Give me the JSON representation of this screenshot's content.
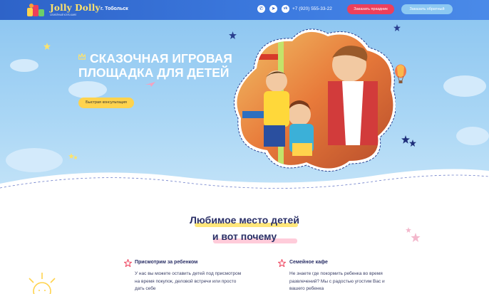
{
  "header": {
    "logo_name": "Jolly Dolly",
    "logo_tagline": "СЕМЕЙНЫЙ КЛУБ-КАФЕ",
    "city": "г. Тобольск",
    "phone": "+7 (920) 555-33-22",
    "order_button": "Заказать праздник",
    "call_button": "Заказать обратный",
    "social_icons": [
      "whatsapp-icon",
      "telegram-icon",
      "vk-icon"
    ]
  },
  "hero": {
    "title": "СКАЗОЧНАЯ ИГРОВАЯ ПЛОЩАДКА ДЛЯ ДЕТЕЙ",
    "consult_button": "Быстрая консультация"
  },
  "section": {
    "heading_line1": "Любимое место детей",
    "heading_line2": "и вот почему",
    "features": [
      {
        "title": "Присмотрим за ребенком",
        "text": "У нас вы можете оставить детей под присмотром на время покупок, деловой встречи или просто дать себе"
      },
      {
        "title": "Семейное кафе",
        "text": "Не знаете где покормить ребенка во время развлечений? Мы с радостью угостим Вас и вашего ребенка"
      }
    ]
  },
  "colors": {
    "header": "#2e63c8",
    "accent_red": "#ee3f5a",
    "accent_yellow": "#ffd34d",
    "heading": "#2a2f66"
  }
}
